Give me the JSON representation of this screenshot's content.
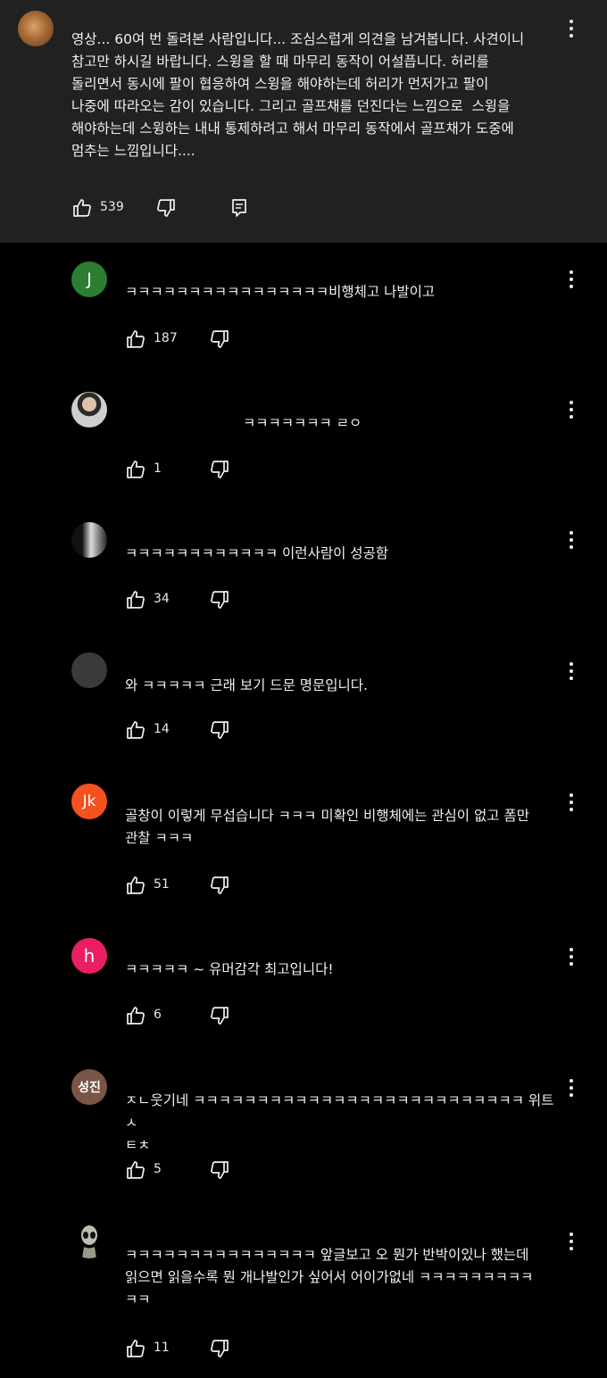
{
  "top_comment": {
    "text": "영상... 60여 번 돌려본 사람입니다... 조심스럽게 의견을 남겨봅니다. 사견이니\n참고만 하시길 바랍니다. 스윙을 할 때 마무리 동작이 어설픕니다. 허리를\n돌리면서 동시에 팔이 협응하여 스윙을 해야하는데 허리가 먼저가고 팔이\n나중에 따라오는 감이 있습니다. 그리고 골프채를 던진다는 느낌으로  스윙을\n해야하는데 스윙하는 내내 통제하려고 해서 마무리 동작에서 골프채가 도중에\n멈추는 느낌입니다....",
    "likes": "539"
  },
  "replies": [
    {
      "avatar_text": "J",
      "text": "ㅋㅋㅋㅋㅋㅋㅋㅋㅋㅋㅋㅋㅋㅋㅋㅋ비행체고 나발이고",
      "likes": "187"
    },
    {
      "avatar_text": "",
      "text": "ㅋㅋㅋㅋㅋㅋㅋ ㄹㅇ",
      "likes": "1"
    },
    {
      "avatar_text": "",
      "text": "ㅋㅋㅋㅋㅋㅋㅋㅋㅋㅋㅋㅋ 이런사람이 성공함",
      "likes": "34"
    },
    {
      "avatar_text": "",
      "text": "와 ㅋㅋㅋㅋㅋ 근래 보기 드문 명문입니다.",
      "likes": "14"
    },
    {
      "avatar_text": "Jk",
      "text": "골창이 이렇게 무섭습니다 ㅋㅋㅋ 미확인 비행체에는 관심이 없고 폼만\n관찰 ㅋㅋㅋ",
      "likes": "51"
    },
    {
      "avatar_text": "h",
      "text": "ㅋㅋㅋㅋㅋ ~ 유머감각 최고입니다!",
      "likes": "6"
    },
    {
      "avatar_text": "성진",
      "text": "ㅈㄴ웃기네 ㅋㅋㅋㅋㅋㅋㅋㅋㅋㅋㅋㅋㅋㅋㅋㅋㅋㅋㅋㅋㅋㅋㅋㅋㅋㅋ 위트 ㅅ\nㅌㅊ",
      "likes": "5"
    },
    {
      "avatar_text": "",
      "text": "ㅋㅋㅋㅋㅋㅋㅋㅋㅋㅋㅋㅋㅋㅋㅋ 앞글보고 오 뭔가 반박이있나 했는데\n읽으면 읽을수록 뭔 개나발인가 싶어서 어이가없네 ㅋㅋㅋㅋㅋㅋㅋㅋㅋ\nㅋㅋ",
      "likes": "11"
    }
  ],
  "icons": {
    "like": "thumbs-up-icon",
    "dislike": "thumbs-down-icon",
    "reply": "reply-comment-icon",
    "menu": "more-vertical-icon"
  },
  "colors": {
    "top_bg": "#212121",
    "page_bg": "#000000",
    "text": "#f1f1f1"
  }
}
